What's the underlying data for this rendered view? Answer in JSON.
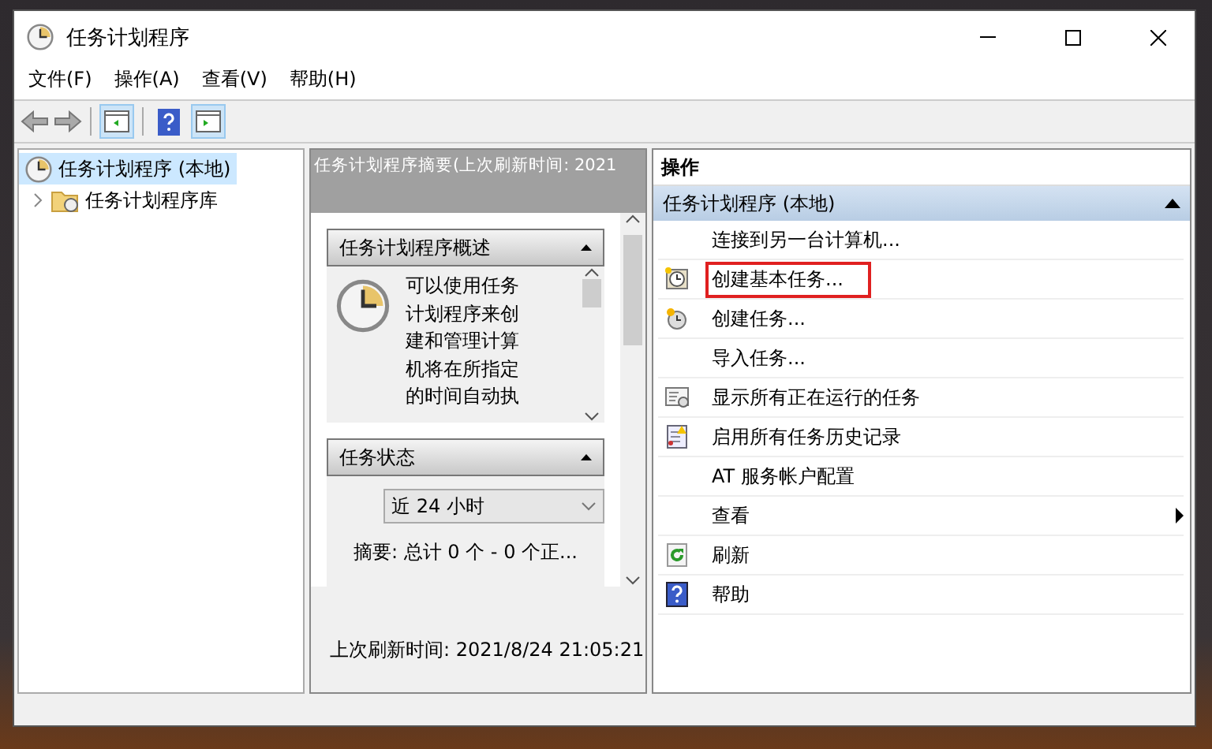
{
  "window": {
    "title": "任务计划程序"
  },
  "menu": [
    "文件(F)",
    "操作(A)",
    "查看(V)",
    "帮助(H)"
  ],
  "tree": [
    {
      "label": "任务计划程序 (本地)",
      "selected": true,
      "children": [
        {
          "label": "任务计划程序库",
          "selected": false,
          "expanded": false
        }
      ]
    }
  ],
  "summary": {
    "header": "任务计划程序摘要(上次刷新时间: 2021",
    "sections": [
      {
        "title": "任务计划程序概述",
        "kind": "overview",
        "text": "可以使用任务计划程序来创建和管理计算机将在所指定的时间自动执"
      },
      {
        "title": "任务状态",
        "kind": "status",
        "dropdown": "近 24 小时",
        "text": "摘要: 总计 0 个 - 0 个正..."
      }
    ],
    "last_refresh": "上次刷新时间: 2021/8/24 21:05:21"
  },
  "actions": {
    "header": "操作",
    "group": "任务计划程序 (本地)",
    "items": [
      {
        "label": "连接到另一台计算机...",
        "kind": "plain",
        "highlighted": false,
        "submenu": false
      },
      {
        "label": "创建基本任务...",
        "kind": "wizard",
        "highlighted": true,
        "submenu": false
      },
      {
        "label": "创建任务...",
        "kind": "task",
        "highlighted": false,
        "submenu": false
      },
      {
        "label": "导入任务...",
        "kind": "plain",
        "highlighted": false,
        "submenu": false
      },
      {
        "label": "显示所有正在运行的任务",
        "kind": "running",
        "highlighted": false,
        "submenu": false
      },
      {
        "label": "启用所有任务历史记录",
        "kind": "history",
        "highlighted": false,
        "submenu": false
      },
      {
        "label": "AT 服务帐户配置",
        "kind": "plain",
        "highlighted": false,
        "submenu": false
      },
      {
        "label": "查看",
        "kind": "plain",
        "highlighted": false,
        "submenu": true
      },
      {
        "label": "刷新",
        "kind": "refresh",
        "highlighted": false,
        "submenu": false
      },
      {
        "label": "帮助",
        "kind": "help",
        "highlighted": false,
        "submenu": false
      }
    ]
  }
}
